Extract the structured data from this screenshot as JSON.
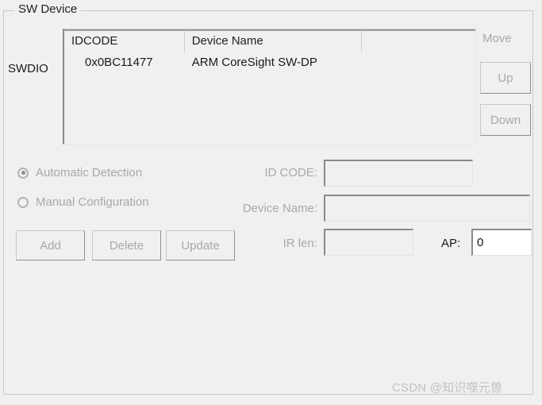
{
  "groupbox": {
    "title": "SW Device"
  },
  "interface": {
    "label": "SWDIO"
  },
  "device_list": {
    "columns": [
      "IDCODE",
      "Device Name",
      ""
    ],
    "rows": [
      {
        "idcode": "0x0BC11477",
        "device_name": "ARM CoreSight SW-DP",
        "extra": ""
      }
    ]
  },
  "move": {
    "label": "Move",
    "up_label": "Up",
    "down_label": "Down"
  },
  "detection": {
    "automatic_label": "Automatic Detection",
    "automatic_selected": true,
    "manual_label": "Manual Configuration",
    "manual_selected": false
  },
  "actions": {
    "add_label": "Add",
    "delete_label": "Delete",
    "update_label": "Update"
  },
  "fields": {
    "id_code_label": "ID CODE:",
    "id_code_value": "",
    "device_name_label": "Device Name:",
    "device_name_value": "",
    "ir_len_label": "IR len:",
    "ir_len_value": "",
    "ap_label": "AP:",
    "ap_value": "0"
  },
  "watermark": {
    "text": "CSDN @知识噬元兽"
  },
  "colors": {
    "window_background": "#f0f0f0",
    "text": "#1a1a1a",
    "disabled_text": "#a8a8a8",
    "border": "#c8c8c8",
    "field_shadow": "#8a8a8a",
    "enabled_field_background": "#ffffff",
    "watermark": "#c2c2c2"
  }
}
